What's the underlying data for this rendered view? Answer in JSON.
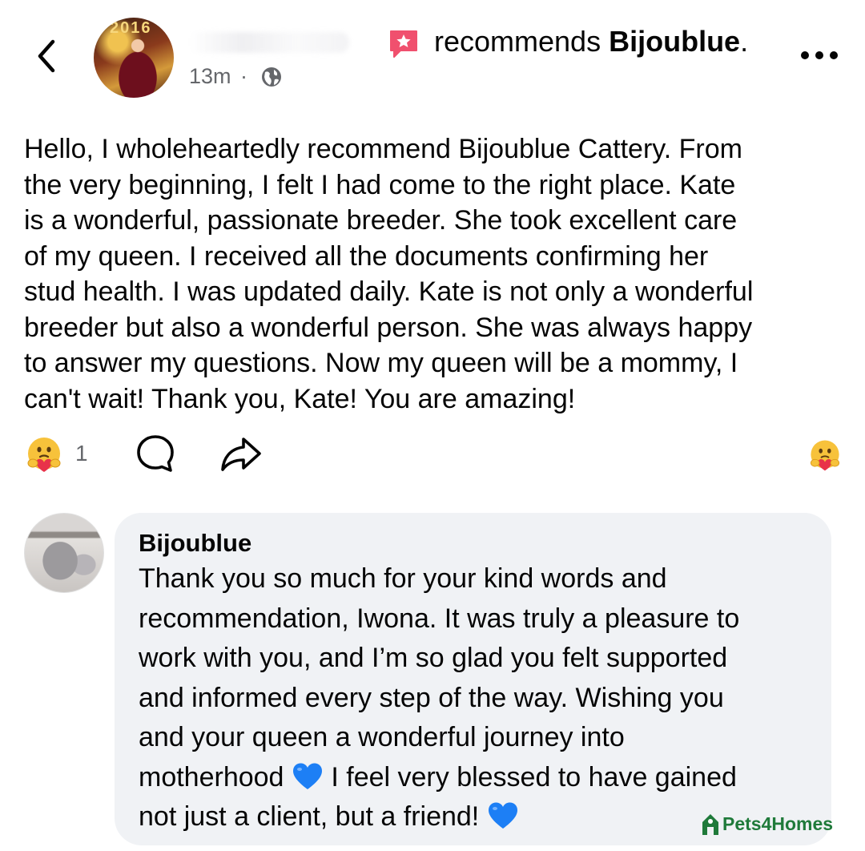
{
  "header": {
    "back_icon": "chevron-left-icon",
    "avatar_year_text": "2016",
    "timestamp": "13m",
    "separator": "·",
    "audience_icon": "globe-icon",
    "recommend_icon": "star-badge-icon",
    "recommends_prefix": "recommends",
    "recommended_page": "Bijoublue",
    "recommends_suffix": ".",
    "more_icon": "more-horizontal-icon"
  },
  "post": {
    "text": "Hello, I wholeheartedly recommend Bijoublue Cattery. From\nthe very beginning, I felt I had come to the right place. Kate\nis a wonderful, passionate breeder. She took excellent care\nof my queen. I received all the documents confirming her\nstud health. I was updated daily. Kate is not only a wonderful\nbreeder but also a wonderful person. She was always happy\nto answer my questions. Now my queen will be a mommy, I\ncan't wait! Thank you, Kate! You are amazing!"
  },
  "actions": {
    "reaction_icon": "care-emoji-icon",
    "reaction_count": "1",
    "comment_icon": "comment-bubble-icon",
    "share_icon": "share-arrow-icon",
    "react_icon": "care-emoji-icon"
  },
  "comment": {
    "author": "Bijoublue",
    "text_part1": "Thank you so much for your kind words and\nrecommendation, Iwona. It was truly a pleasure to\nwork with you, and I’m so glad you felt supported\nand informed every step of the way. Wishing you\nand your queen a wonderful journey into\nmotherhood ",
    "text_part2": " I feel very blessed to have gained\nnot just a client, but a friend! ",
    "heart_icon": "blue-heart-icon"
  },
  "watermark": {
    "text": "Pets4Homes"
  },
  "colors": {
    "text_primary": "#050505",
    "text_secondary": "#65676b",
    "bubble": "#f0f2f5",
    "recommend_red": "#f0506e",
    "heart_blue": "#1d7ff5",
    "watermark_green": "#1f7a3a"
  }
}
